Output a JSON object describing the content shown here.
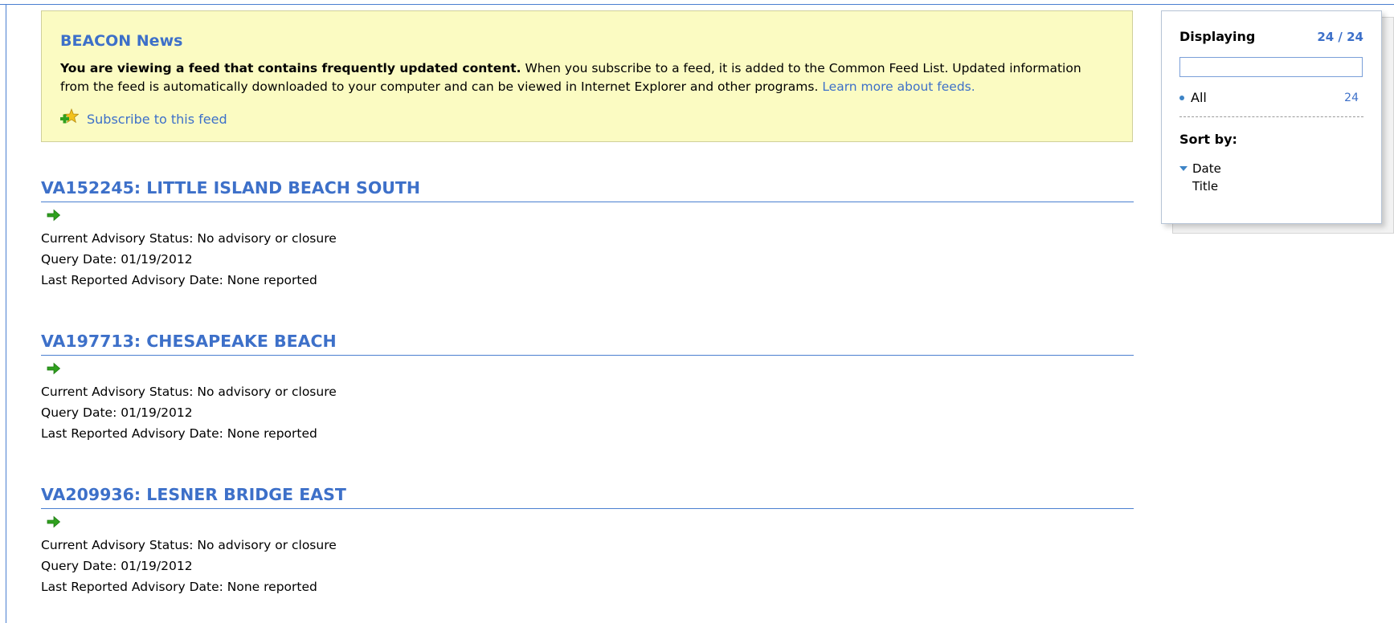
{
  "info": {
    "title": "BEACON News",
    "bold_text": "You are viewing a feed that contains frequently updated content.",
    "body_text": " When you subscribe to a feed, it is added to the Common Feed List. Updated information from the feed is automatically downloaded to your computer and can be viewed in Internet Explorer and other programs. ",
    "learn_more": "Learn more about feeds.",
    "subscribe": "Subscribe to this feed",
    "subscribe_icon": "star-plus-icon"
  },
  "items": [
    {
      "title": "VA152245: LITTLE ISLAND BEACH SOUTH",
      "status": "Current Advisory Status: No advisory or closure",
      "query_date": "Query Date: 01/19/2012",
      "last_reported": "Last Reported Advisory Date: None reported"
    },
    {
      "title": "VA197713: CHESAPEAKE BEACH",
      "status": "Current Advisory Status: No advisory or closure",
      "query_date": "Query Date: 01/19/2012",
      "last_reported": "Last Reported Advisory Date: None reported"
    },
    {
      "title": "VA209936: LESNER BRIDGE EAST",
      "status": "Current Advisory Status: No advisory or closure",
      "query_date": "Query Date: 01/19/2012",
      "last_reported": "Last Reported Advisory Date: None reported"
    }
  ],
  "panel": {
    "displaying_label": "Displaying",
    "displaying_count": "24 / 24",
    "filter_value": "",
    "all_label": "All",
    "all_count": "24",
    "sort_label": "Sort by:",
    "sort_options": [
      "Date",
      "Title"
    ],
    "sort_selected": "Date"
  },
  "colors": {
    "link": "#3d70c9",
    "info_background": "#fbfbc2",
    "arrow": "#2fa01e"
  }
}
